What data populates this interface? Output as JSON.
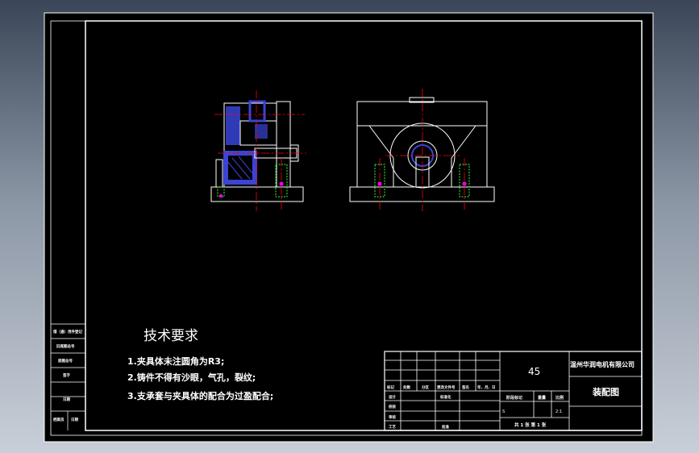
{
  "drawing": {
    "technical_requirements": {
      "heading": "技术要求",
      "items": [
        "1.夹具体未注圆角为R3;",
        "2.铸件不得有沙眼，气孔，裂纹;",
        "3.支承套与夹具体的配合为过盈配合;"
      ]
    },
    "title_block": {
      "material": "45",
      "company": "温州华润电机有限公司",
      "drawing_name": "装配图",
      "header_cols": [
        "标记",
        "处数",
        "分区",
        "更改文件号",
        "签名",
        "年、月、日"
      ],
      "rows": [
        "设计",
        "校核",
        "审核",
        "工艺"
      ],
      "standardize_label": "标准化",
      "approve_label": "批准",
      "stage_label": "阶段标记",
      "weight_label": "重量",
      "scale_label": "比例",
      "stage_value": "S",
      "scale_value": "2:1",
      "sheets": "共 1 张   第 1 张"
    },
    "left_strip": [
      "借（通）用件登记",
      "旧底图总号",
      "底图总号",
      "签字",
      "日期",
      "档案员",
      "日期"
    ]
  },
  "colors": {
    "background": "#000000",
    "line": "#ffffff",
    "center_line": "#ff0000",
    "section_fill": "#3a44d6",
    "bolt": "#33cc33",
    "marker": "#ff00ff"
  }
}
